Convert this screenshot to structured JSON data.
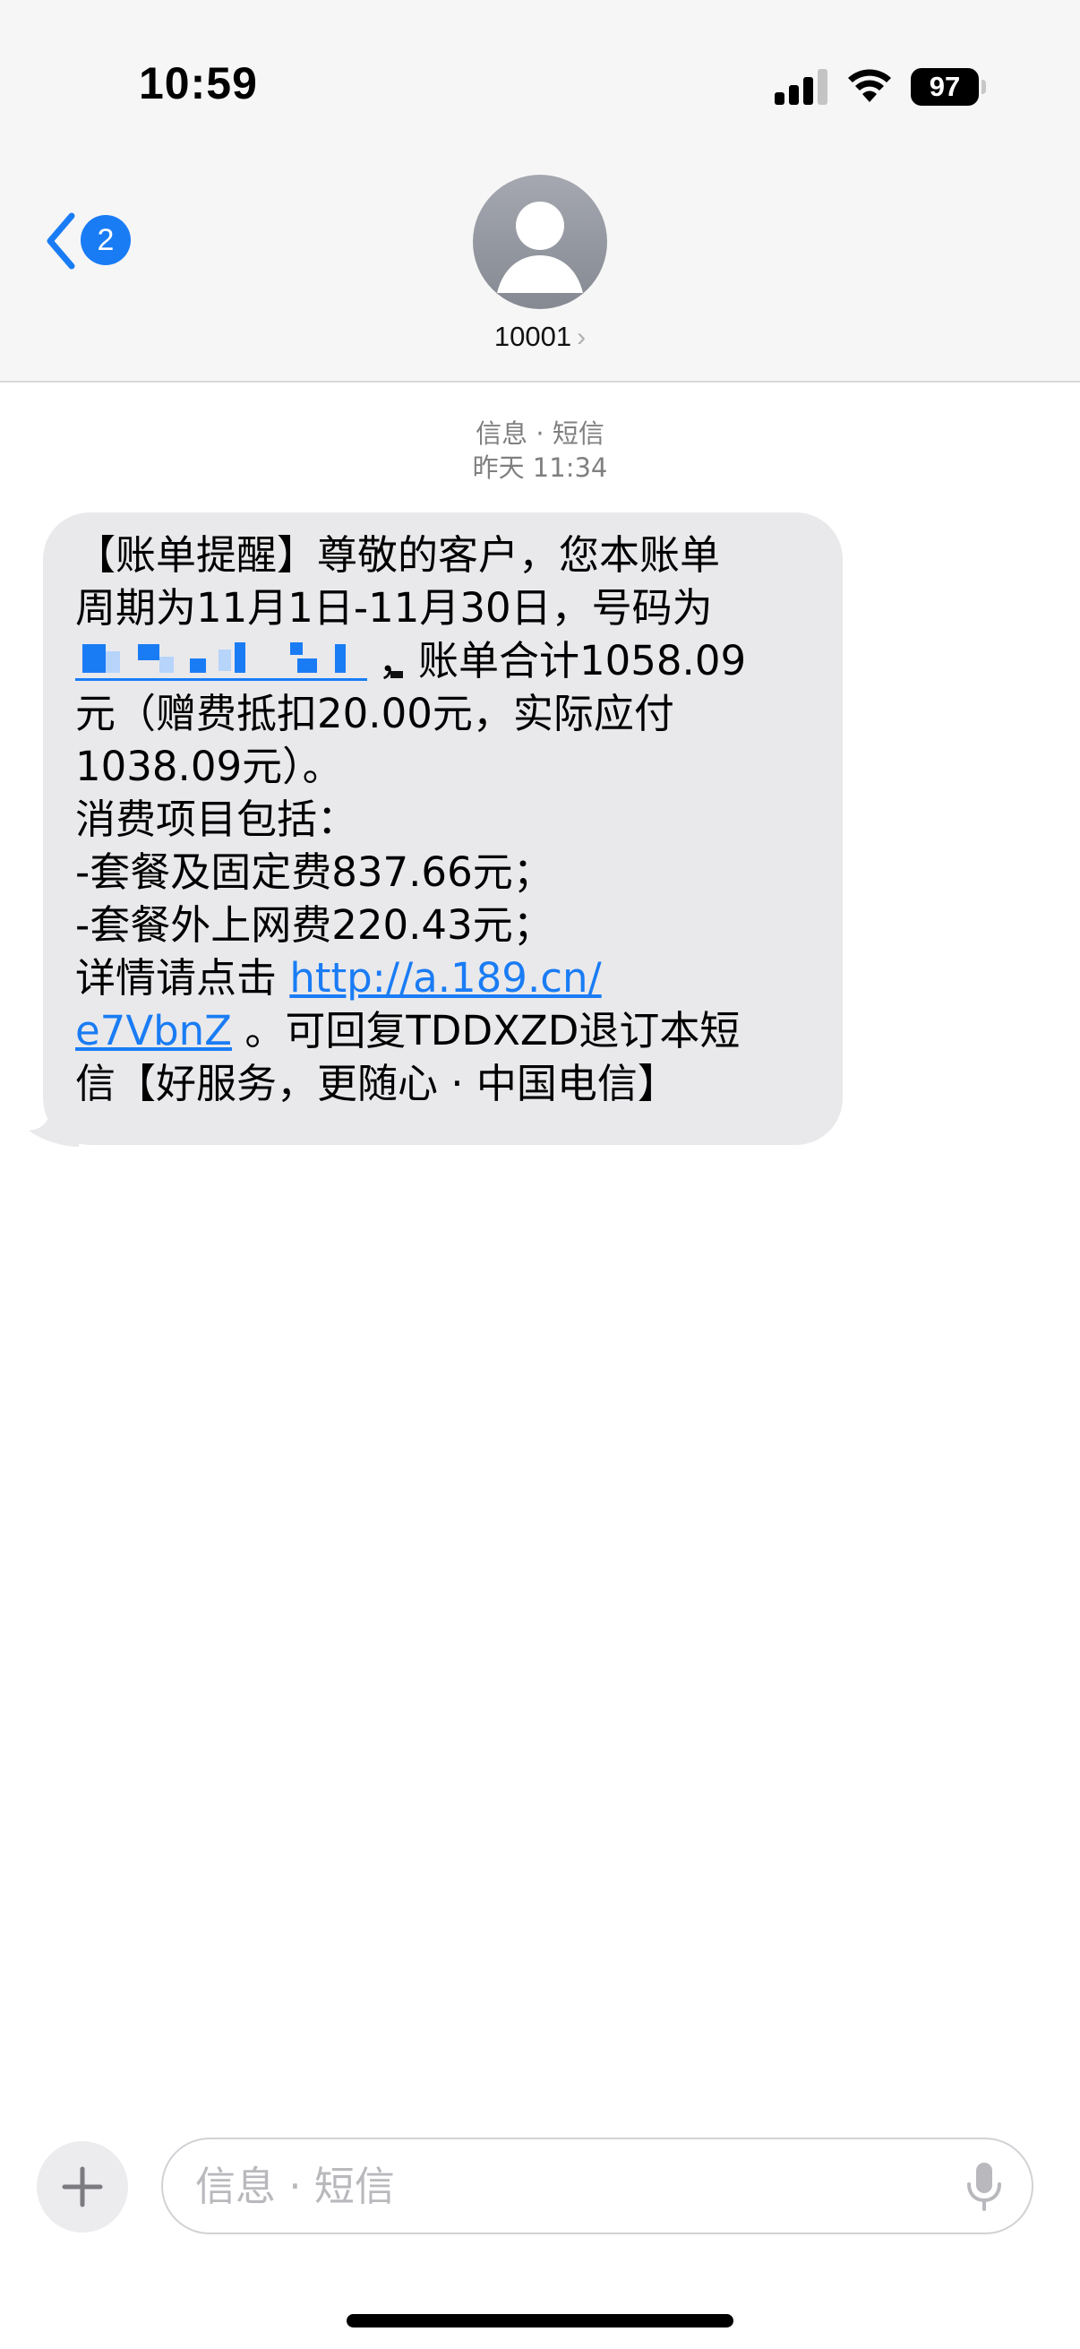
{
  "status_bar": {
    "time": "10:59",
    "battery": "97"
  },
  "header": {
    "back_badge_count": "2",
    "contact_name": "10001",
    "contact_chevron": "›"
  },
  "conversation": {
    "service_label": "信息 · 短信",
    "timestamp": "昨天 11:34"
  },
  "message": {
    "line1": "【账单提醒】尊敬的客户，您本账单",
    "line2": "周期为11月1日-11月30日，号码为",
    "line3_after_redaction": "，账单合计1058.09",
    "line4": "元（赠费抵扣20.00元，实际应付",
    "line5": "1038.09元）。",
    "line6": "消费项目包括：",
    "line7": "-套餐及固定费837.66元；",
    "line8": "-套餐外上网费220.43元；",
    "line9_prefix": "详情请点击 ",
    "link_part1": "http://a.189.cn/",
    "link_part2": "e7VbnZ",
    "line10_suffix": " 。可回复TDDXZD退订本短",
    "line11": "信【好服务，更随心 · 中国电信】"
  },
  "input_bar": {
    "placeholder": "信息 · 短信",
    "add_symbol": "+"
  },
  "icons": {
    "back": "chevron-left-icon",
    "avatar": "person-icon",
    "add": "plus-icon",
    "mic": "microphone-icon",
    "signal": "cellular-signal-icon",
    "wifi": "wifi-icon"
  },
  "colors": {
    "accent": "#1a7cf5",
    "bubble": "#e9e9eb",
    "header_bg": "#f6f6f6"
  }
}
